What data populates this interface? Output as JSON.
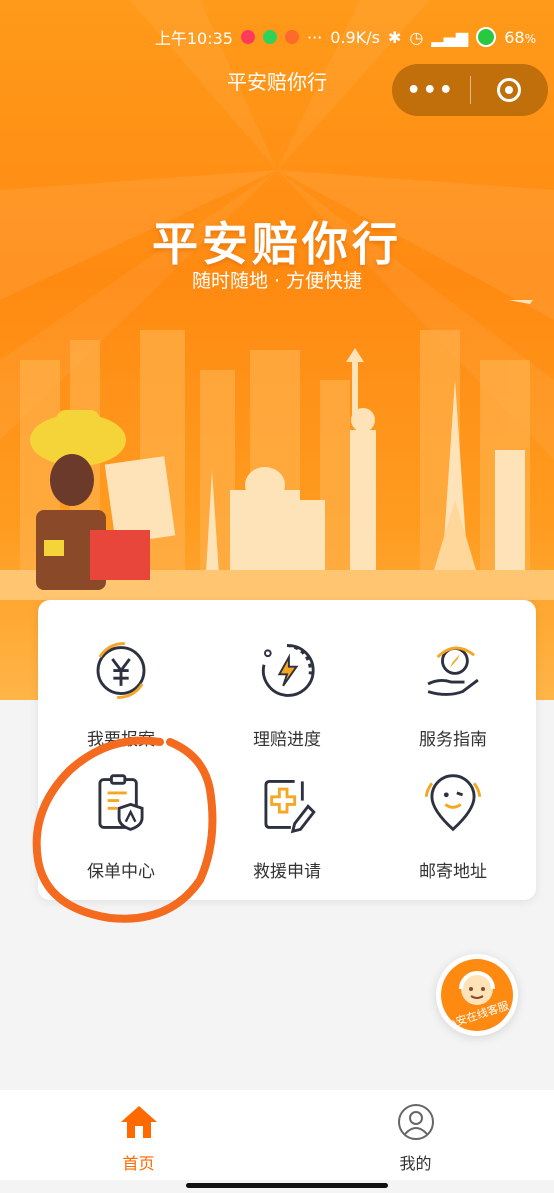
{
  "status_bar": {
    "time": "上午10:35",
    "more": "···",
    "network_speed": "0.9K/s",
    "battery": "68",
    "battery_unit": "%"
  },
  "nav": {
    "title": "平安赔你行",
    "more_glyph": "•••"
  },
  "hero": {
    "title": "平安赔你行",
    "subtitle": "随时随地 · 方便快捷"
  },
  "menu": [
    {
      "label": "我要报案",
      "icon": "yuan-report-icon"
    },
    {
      "label": "理赔进度",
      "icon": "lightning-progress-icon"
    },
    {
      "label": "服务指南",
      "icon": "hand-compass-icon"
    },
    {
      "label": "保单中心",
      "icon": "policy-shield-icon"
    },
    {
      "label": "救援申请",
      "icon": "rescue-cross-icon"
    },
    {
      "label": "邮寄地址",
      "icon": "location-smile-icon"
    }
  ],
  "floating_service": {
    "label": "小安在线客服",
    "icon": "customer-service-avatar-icon"
  },
  "tabbar": [
    {
      "label": "首页",
      "icon": "home-icon",
      "active": true
    },
    {
      "label": "我的",
      "icon": "user-icon",
      "active": false
    }
  ],
  "colors": {
    "brand_orange": "#ff8a12",
    "active_tab": "#ff6a00",
    "icon_dark": "#2d3140",
    "icon_accent": "#f5a623",
    "annotation": "#f46a1f"
  }
}
